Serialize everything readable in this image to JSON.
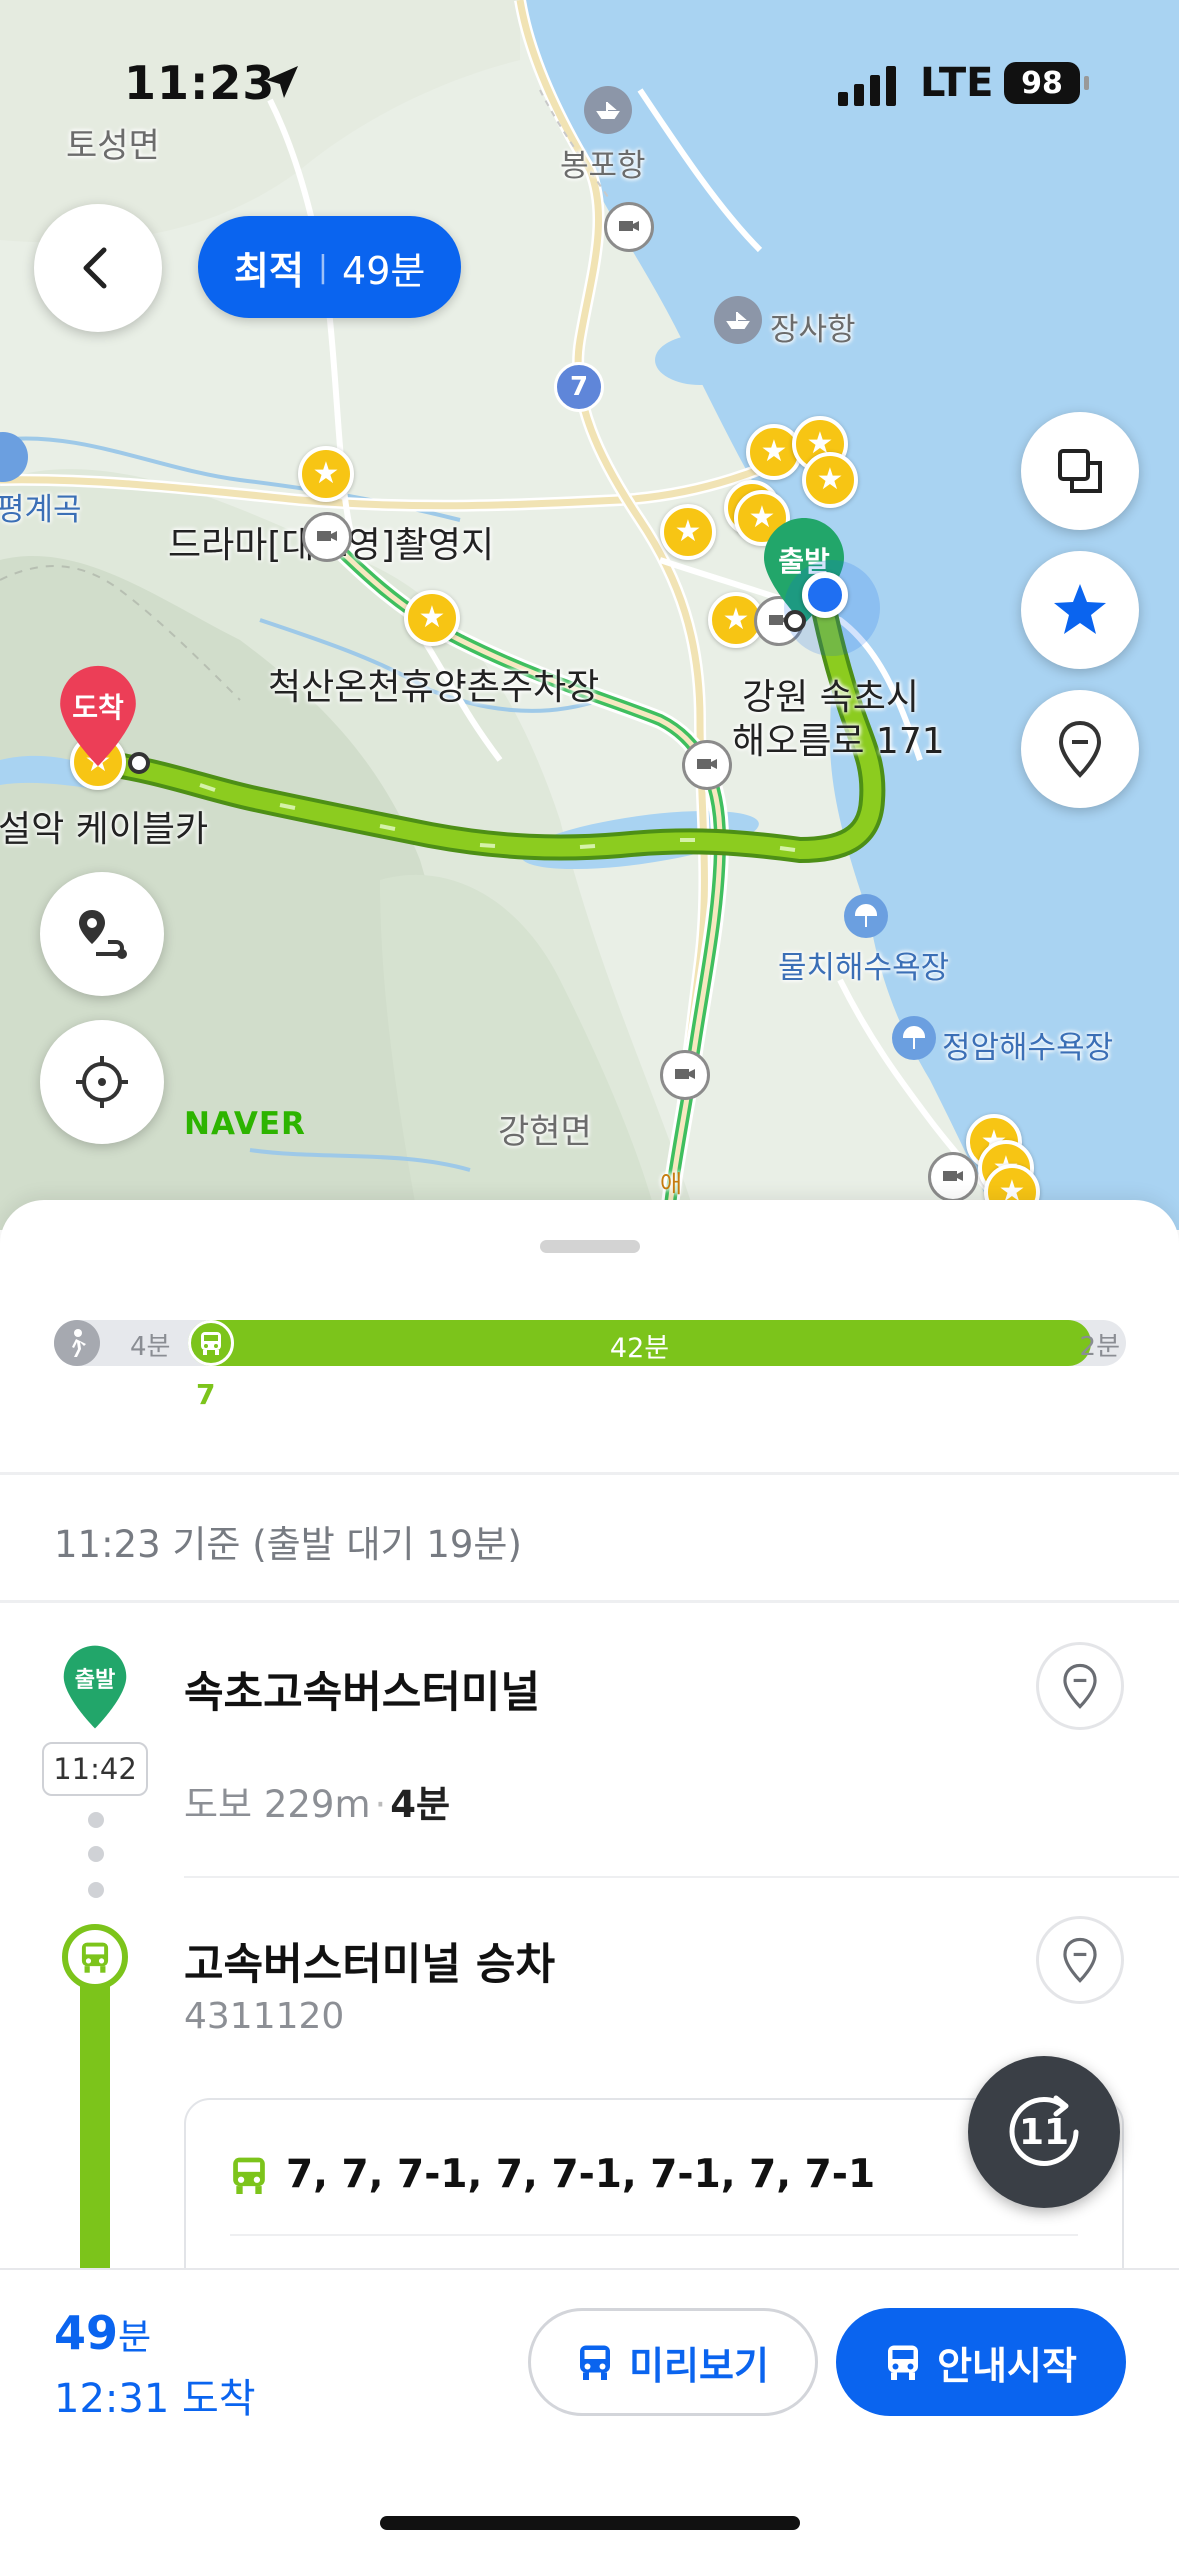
{
  "status_bar": {
    "time": "11:23",
    "network": "LTE",
    "battery": "98"
  },
  "colors": {
    "accent": "#0a64ef",
    "bus_green": "#7cc41b",
    "start_marker": "#22a66a",
    "dest_marker": "#ec3e57",
    "star": "#f7c514"
  },
  "map": {
    "route_pill": {
      "mode": "최적",
      "separator": "|",
      "duration": "49분"
    },
    "labels": {
      "toseong": "토성면",
      "bongpo": "봉포항",
      "jangsa": "장사항",
      "road7": "7",
      "pyeonggye": "평계곡",
      "drama": "드라마[대조영]촬영지",
      "cheoksan": "척산온천휴양촌주차장",
      "address_line1": "강원 속초시",
      "address_line2": "해오름로 171",
      "seorak": "설악 케이블카",
      "mulchi": "물치해수욕장",
      "jeongam": "정암해수욕장",
      "ganghyeon": "강현면",
      "ae": "애"
    },
    "start_marker": "출발",
    "dest_marker": "도착",
    "brand": "NAVER",
    "icons": [
      "back-icon",
      "layers-icon",
      "star-icon",
      "pin-icon",
      "route-options-icon",
      "locate-icon"
    ]
  },
  "summary": {
    "walk_start": "4분",
    "bus": "42분",
    "walk_end": "2분",
    "bus_line": "7",
    "bus_share": 0.857
  },
  "basis_text": "11:23 기준 (출발 대기 19분)",
  "timeline": {
    "stop1": {
      "badge": "출발",
      "time": "11:42",
      "title": "속초고속버스터미널",
      "walk_label": "도보 229m",
      "walk_sep": "·",
      "walk_time": "4분"
    },
    "stop2": {
      "title": "고속버스터미널 승차",
      "stop_id": "4311120",
      "bus_lines": "7, 7, 7-1, 7, 7-1, 7-1, 7, 7-1"
    },
    "refresh_count": "11"
  },
  "bottom": {
    "duration_num": "49",
    "duration_unit": "분",
    "arrival": "12:31 도착",
    "preview_label": "미리보기",
    "start_label": "안내시작"
  }
}
